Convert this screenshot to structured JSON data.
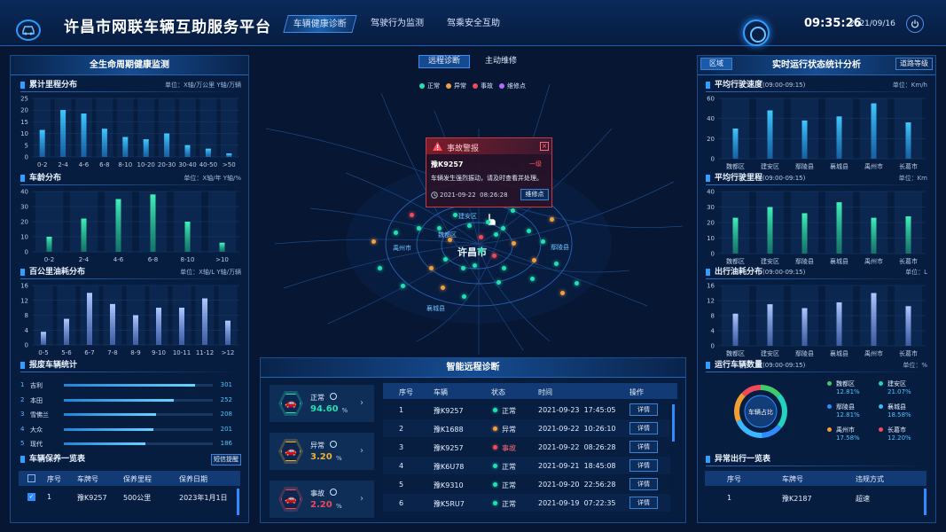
{
  "app": {
    "title": "许昌市网联车辆互助服务平台",
    "time": "09:35:26",
    "date": "2021/09/16"
  },
  "nav": {
    "tabs": [
      {
        "label": "车辆健康诊断",
        "active": true
      },
      {
        "label": "驾驶行为监测",
        "active": false
      },
      {
        "label": "驾乘安全互助",
        "active": false
      }
    ]
  },
  "map_tabs": [
    {
      "label": "远程诊断",
      "active": true
    },
    {
      "label": "主动维修",
      "active": false
    }
  ],
  "map_legend": [
    {
      "label": "正常",
      "color": "#22e0b0"
    },
    {
      "label": "异常",
      "color": "#f0a040"
    },
    {
      "label": "事故",
      "color": "#f04a5a"
    },
    {
      "label": "维修点",
      "color": "#b06cff"
    }
  ],
  "map_labels": {
    "city": "许昌市",
    "d1": "建安区",
    "d2": "魏都区",
    "d3": "禹州市",
    "d4": "鄢陵县",
    "d5": "襄城县"
  },
  "alert": {
    "title": "事故警报",
    "plate": "豫K9257",
    "level": "一级",
    "message": "车辆发生强烈振动，请及时查看并处理。",
    "time": "2021-09-22  08:26:28",
    "button": "维修点"
  },
  "left": {
    "title": "全生命周期健康监测",
    "mileage": {
      "title": "累计里程分布",
      "unit": "单位：X轴/万公里 Y轴/万辆"
    },
    "age": {
      "title": "车龄分布",
      "unit": "单位：X轴/年 Y轴/%"
    },
    "fuel": {
      "title": "百公里油耗分布",
      "unit": "单位：X轴/L Y轴/万辆"
    },
    "scrap": {
      "title": "报废车辆统计",
      "items": [
        {
          "rank": "1",
          "name": "吉利",
          "value": "301",
          "ratio": 0.88
        },
        {
          "rank": "2",
          "name": "本田",
          "value": "252",
          "ratio": 0.74
        },
        {
          "rank": "3",
          "name": "雪佛兰",
          "value": "208",
          "ratio": 0.62
        },
        {
          "rank": "4",
          "name": "大众",
          "value": "201",
          "ratio": 0.6
        },
        {
          "rank": "5",
          "name": "现代",
          "value": "186",
          "ratio": 0.55
        }
      ]
    },
    "maint": {
      "title": "车辆保养一览表",
      "button": "短信提醒",
      "headers": [
        "序号",
        "车牌号",
        "保养里程",
        "保养日期"
      ],
      "row": {
        "no": "1",
        "plate": "豫K9257",
        "mileage": "500公里",
        "date": "2023年1月1日"
      }
    }
  },
  "right": {
    "title": "实时运行状态统计分析",
    "left_button": "区域",
    "right_button": "道路等级",
    "speed": {
      "title": "平均行驶速度",
      "period": "(09:00-09:15)",
      "unit": "单位：Km/h"
    },
    "dist": {
      "title": "平均行驶里程",
      "period": "(09:00-09:15)",
      "unit": "单位：Km"
    },
    "fuel": {
      "title": "出行油耗分布",
      "period": "(09:00-09:15)",
      "unit": "单位：L"
    },
    "count": {
      "title": "运行车辆数量",
      "period": "(09:00-09:15)",
      "unit": "单位：%",
      "donut_label": "车辆占比",
      "items": [
        {
          "name": "魏都区",
          "value": "12.81%",
          "color": "#3ecb6a"
        },
        {
          "name": "建安区",
          "value": "21.07%",
          "color": "#22d3c0"
        },
        {
          "name": "鄢陵县",
          "value": "12.81%",
          "color": "#2f8cff"
        },
        {
          "name": "襄城县",
          "value": "18.58%",
          "color": "#3bb8ff"
        },
        {
          "name": "禹州市",
          "value": "17.58%",
          "color": "#f0a030"
        },
        {
          "name": "长葛市",
          "value": "12.20%",
          "color": "#f04a5a"
        }
      ]
    },
    "abnormal": {
      "title": "异常出行一览表",
      "headers": [
        "序号",
        "车牌号",
        "违规方式"
      ],
      "row": {
        "no": "1",
        "plate": "豫K2187",
        "type": "超速"
      }
    }
  },
  "center": {
    "title": "智能远程诊断",
    "stats": [
      {
        "label": "正常",
        "value": "94.60",
        "unit": "%",
        "color": "#22e0b0"
      },
      {
        "label": "异常",
        "value": "3.20",
        "unit": "%",
        "color": "#f0b030"
      },
      {
        "label": "事故",
        "value": "2.20",
        "unit": "%",
        "color": "#f04a5a"
      }
    ],
    "headers": [
      "序号",
      "车辆",
      "状态",
      "时间",
      "操作"
    ],
    "rows": [
      {
        "no": "1",
        "plate": "豫K9257",
        "status": "正常",
        "time": "2021-09-23  17:45:05",
        "action": "详情"
      },
      {
        "no": "2",
        "plate": "豫K1688",
        "status": "异常",
        "time": "2021-09-22  10:26:10",
        "action": "详情"
      },
      {
        "no": "3",
        "plate": "豫K9257",
        "status": "事故",
        "time": "2021-09-22  08:26:28",
        "action": "详情"
      },
      {
        "no": "4",
        "plate": "豫K6U78",
        "status": "正常",
        "time": "2021-09-21  18:45:08",
        "action": "详情"
      },
      {
        "no": "5",
        "plate": "豫K9310",
        "status": "正常",
        "time": "2021-09-20  22:56:28",
        "action": "详情"
      },
      {
        "no": "6",
        "plate": "豫K5RU7",
        "status": "正常",
        "time": "2021-09-19  07:22:35",
        "action": "详情"
      }
    ]
  },
  "chart_data": [
    {
      "type": "bar",
      "name": "mileage",
      "categories": [
        "0-2",
        "2-4",
        "4-6",
        "6-8",
        "8-10",
        "10-20",
        "20-30",
        "30-40",
        "40-50",
        ">50"
      ],
      "values": [
        11.5,
        20,
        18.5,
        12,
        8.5,
        7.5,
        10,
        5,
        3.5,
        1.5
      ],
      "ylim": [
        0,
        25
      ],
      "yticks": [
        0,
        5,
        10,
        15,
        20,
        25
      ]
    },
    {
      "type": "bar",
      "name": "age",
      "categories": [
        "0-2",
        "2-4",
        "4-6",
        "6-8",
        "8-10",
        ">10"
      ],
      "values": [
        10,
        22,
        35,
        38,
        20,
        6
      ],
      "ylim": [
        0,
        40
      ],
      "yticks": [
        0,
        10,
        20,
        30,
        40
      ]
    },
    {
      "type": "bar",
      "name": "fuel100",
      "categories": [
        "0-5",
        "5-6",
        "6-7",
        "7-8",
        "8-9",
        "9-10",
        "10-11",
        "11-12",
        ">12"
      ],
      "values": [
        3.5,
        7,
        14,
        11,
        8,
        10,
        10,
        12.5,
        6.5
      ],
      "ylim": [
        0,
        16
      ],
      "yticks": [
        0,
        4,
        8,
        12,
        16
      ]
    },
    {
      "type": "bar",
      "name": "speed",
      "categories": [
        "魏都区",
        "建安区",
        "鄢陵县",
        "襄城县",
        "禹州市",
        "长葛市"
      ],
      "values": [
        30,
        48,
        38,
        42,
        55,
        36
      ],
      "ylim": [
        0,
        60
      ],
      "yticks": [
        0,
        20,
        40,
        60
      ]
    },
    {
      "type": "bar",
      "name": "distance",
      "categories": [
        "魏都区",
        "建安区",
        "鄢陵县",
        "襄城县",
        "禹州市",
        "长葛市"
      ],
      "values": [
        23,
        30,
        26,
        33,
        23,
        24
      ],
      "ylim": [
        0,
        40
      ],
      "yticks": [
        0,
        10,
        20,
        30,
        40
      ]
    },
    {
      "type": "bar",
      "name": "trip_fuel",
      "categories": [
        "魏都区",
        "建安区",
        "鄢陵县",
        "襄城县",
        "禹州市",
        "长葛市"
      ],
      "values": [
        8.5,
        11,
        10,
        11.5,
        14,
        10.5
      ],
      "ylim": [
        0,
        16
      ],
      "yticks": [
        0,
        4,
        8,
        12,
        16
      ]
    },
    {
      "type": "pie",
      "name": "vehicle_share",
      "categories": [
        "魏都区",
        "建安区",
        "鄢陵县",
        "襄城县",
        "禹州市",
        "长葛市"
      ],
      "values": [
        12.81,
        21.07,
        12.81,
        18.58,
        17.58,
        12.2
      ]
    }
  ]
}
